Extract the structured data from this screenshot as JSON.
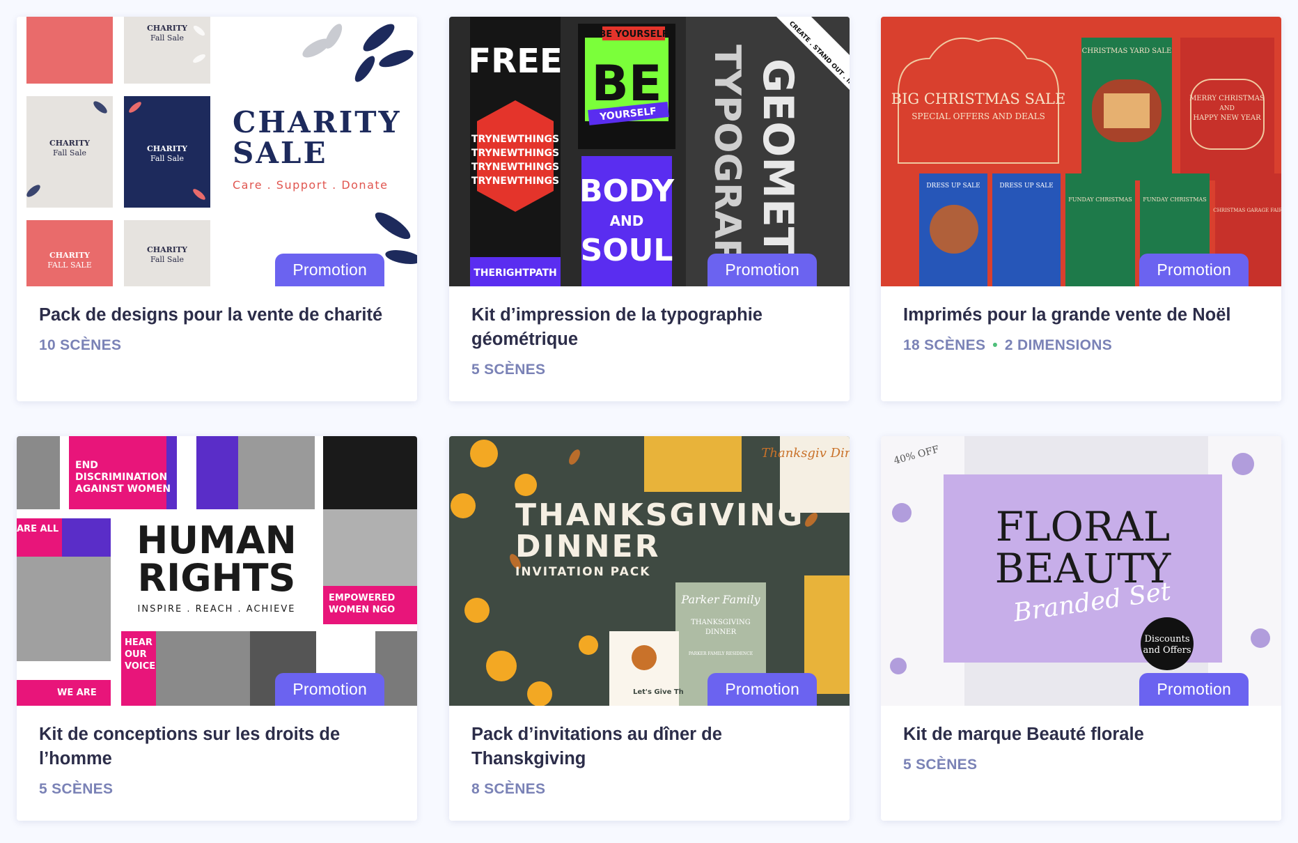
{
  "cards": [
    {
      "title": "Pack de designs pour la vente de charité",
      "meta": "10 SCÈNES",
      "badge": "Promotion",
      "art": {
        "heading_line1": "CHARITY",
        "heading_line2": "SALE",
        "tagline": "Care . Support . Donate",
        "flyer_small_line1": "CHARITY",
        "flyer_small_line2": "Fall Sale",
        "flyer_dark_line1": "CHARITY",
        "flyer_dark_line2": "Fall Sale",
        "flyer_red_line1": "CHARITY",
        "flyer_red_line2": "FALL SALE"
      }
    },
    {
      "title": "Kit d’impression de la typographie géométrique",
      "meta": "5 SCÈNES",
      "badge": "Promotion",
      "art": {
        "word_free": "FREE",
        "word_be": "BE",
        "label_be_yourself": "BE YOURSELF",
        "label_yourself": "YOURSELF",
        "word_try": "TRYNEWTHINGS",
        "word_body": "BODY",
        "word_and": "AND",
        "word_soul": "SOUL",
        "word_right_path": "THERIGHTPATH",
        "word_typography": "TYPOGRAPHY",
        "word_geometric": "GEOMETRIC",
        "corner_ribbon": "CREATE . STAND OUT . IMPR"
      }
    },
    {
      "title": "Imprimés pour la grande vente de Noël",
      "meta_left": "18 SCÈNES",
      "meta_right": "2 DIMENSIONS",
      "badge": "Promotion",
      "art": {
        "heading": "BIG CHRISTMAS SALE",
        "subheading": "SPECIAL OFFERS AND DEALS",
        "yard_sale": "CHRISTMAS YARD SALE",
        "merry_line1": "MERRY CHRISTMAS",
        "merry_line2": "AND",
        "merry_line3": "HAPPY NEW YEAR",
        "dress_up": "DRESS UP SALE",
        "sunday_christmas": "FUNDAY CHRISTMAS",
        "garage_fair": "CHRISTMAS GARAGE FAIR"
      }
    },
    {
      "title": "Kit de conceptions sur les droits de l’homme",
      "meta": "5 SCÈNES",
      "badge": "Promotion",
      "art": {
        "heading_line1": "HUMAN",
        "heading_line2": "RIGHTS",
        "tagline": "INSPIRE . REACH . ACHIEVE",
        "end_discrimination_line1": "END",
        "end_discrimination_line2": "DISCRIMINATION",
        "end_discrimination_line3": "AGAINST WOMEN",
        "empowered_line1": "EMPOWERED",
        "empowered_line2": "WOMEN NGO",
        "hear_line1": "HEAR",
        "hear_line2": "OUR",
        "hear_line3": "VOICE",
        "we_are": "WE ARE",
        "are_all": "ARE ALL"
      }
    },
    {
      "title": "Pack d’invitations au dîner de Thanskgiving",
      "meta": "8 SCÈNES",
      "badge": "Promotion",
      "art": {
        "heading_line1": "THANKSGIVING",
        "heading_line2": "DINNER",
        "subheading": "INVITATION PACK",
        "card_script": "Parker Family",
        "card_title_line1": "THANKSGIVING",
        "card_title_line2": "DINNER",
        "card_footer": "PARKER FAMILY RESIDENCE",
        "lets_give": "Let's Give Th",
        "corner_script": "Thanksgiv Dinne"
      }
    },
    {
      "title": "Kit de marque Beauté florale",
      "meta": "5 SCÈNES",
      "badge": "Promotion",
      "art": {
        "heading_line1": "FLORAL",
        "heading_line2": "BEAUTY",
        "script": "Branded Set",
        "percent_off": "40% OFF",
        "badge_line1": "Discounts",
        "badge_line2": "and Offers"
      }
    }
  ],
  "colors": {
    "accent": "#6b63f0",
    "title_text": "#2c2d49",
    "meta_text": "#7a82b6",
    "dot": "#4fbf7a"
  }
}
